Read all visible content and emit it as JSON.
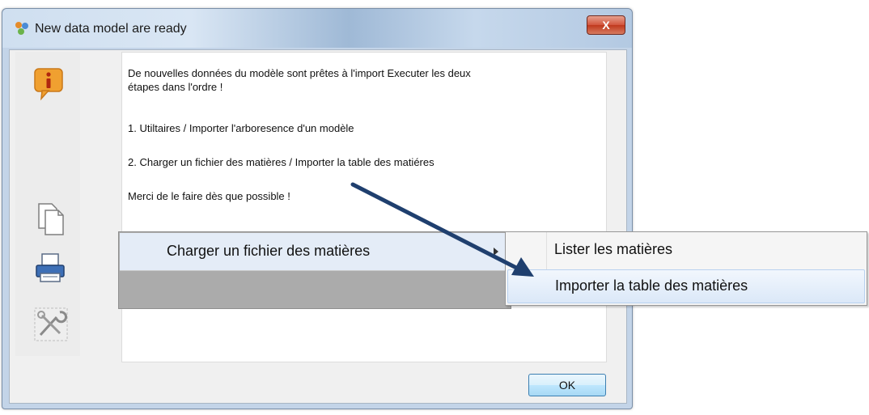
{
  "window": {
    "title": "New data model are ready",
    "close_label": "X"
  },
  "message": {
    "line1": "De nouvelles données du modèle sont prêtes à l'import Executer les deux",
    "line1b": "étapes dans l'ordre !",
    "step1": "1. Utiltaires / Importer l'arboresence d'un modèle",
    "step2": "2. Charger un fichier des matières / Importer la table des matiéres",
    "closing": "Merci de le faire dès que possible !"
  },
  "buttons": {
    "ok": "OK"
  },
  "context_menu": {
    "item": "Charger un fichier des matières",
    "submenu": [
      {
        "label": "Lister les matières"
      },
      {
        "label": "Importer la table des matières",
        "highlighted": true
      }
    ]
  },
  "icons": {
    "title": "app-icon",
    "info": "info-icon",
    "copy": "copy-icon",
    "print": "printer-icon",
    "tools": "tools-icon"
  },
  "colors": {
    "arrow": "#1f3f6e",
    "info_orange": "#f0a030",
    "ok_border": "#3c7fb1"
  }
}
